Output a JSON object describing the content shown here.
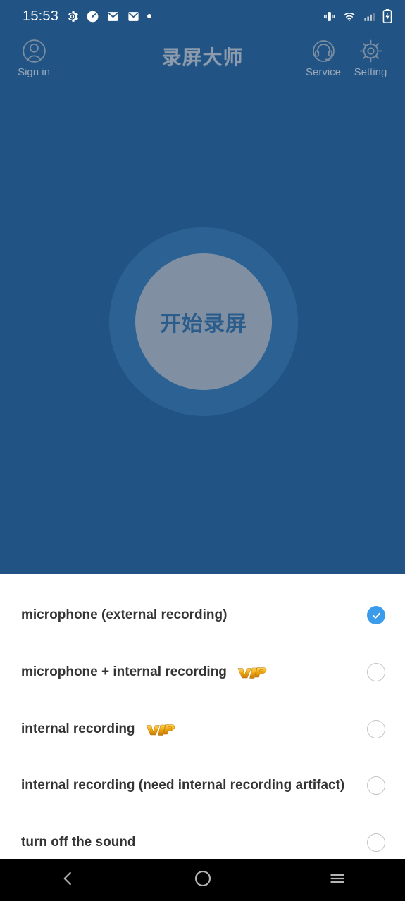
{
  "status_bar": {
    "time": "15:53",
    "left_icons": [
      "gear-icon",
      "speedometer-icon",
      "mail-icon",
      "mail-icon",
      "dot-icon"
    ],
    "right_icons": [
      "vibrate-icon",
      "wifi-icon",
      "signal-icon",
      "battery-charging-icon"
    ]
  },
  "header": {
    "title": "录屏大师",
    "sign_in_label": "Sign in",
    "service_label": "Service",
    "setting_label": "Setting"
  },
  "record": {
    "button_label": "开始录屏"
  },
  "options": {
    "items": [
      {
        "label": "microphone (external recording)",
        "vip": false,
        "selected": true
      },
      {
        "label": "microphone + internal recording",
        "vip": true,
        "selected": false
      },
      {
        "label": "internal recording",
        "vip": true,
        "selected": false
      },
      {
        "label": "internal recording (need internal recording artifact)",
        "vip": false,
        "selected": false
      },
      {
        "label": "turn off the sound",
        "vip": false,
        "selected": false
      }
    ],
    "vip_badge_text": "VIP"
  },
  "navigation": {
    "back_label": "back-icon",
    "home_label": "home-icon",
    "menu_label": "menu-icon"
  },
  "colors": {
    "hero_background": "#215484",
    "record_outer_ring": "#2c6193",
    "record_inner_circle": "#8090a2",
    "record_text": "#2a5c8c",
    "accent_check": "#3c9cec",
    "vip_gold": "#e8a317",
    "option_text": "#333333",
    "header_label": "#9aa9bb",
    "navbar_background": "#000000"
  }
}
